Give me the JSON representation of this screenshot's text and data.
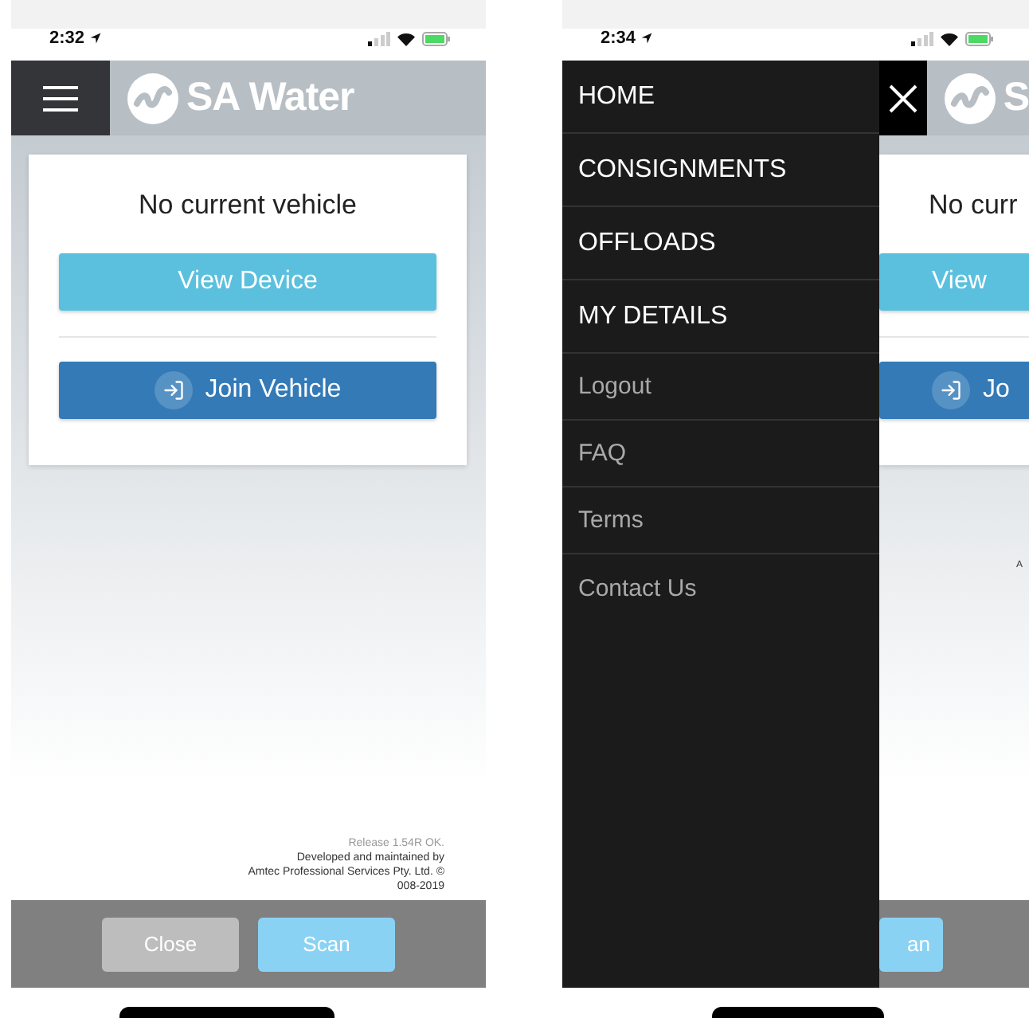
{
  "screens": [
    {
      "kind": "main",
      "status_bar": {
        "time": "2:32"
      },
      "header": {
        "logo_text": "SA Water"
      },
      "card": {
        "message": "No current vehicle",
        "buttons": [
          {
            "label": "View Device",
            "kind": "info"
          },
          {
            "label": "Join Vehicle",
            "kind": "primary"
          }
        ]
      },
      "footer": [
        "Release 1.54R OK.",
        "Developed and maintained by",
        "Amtec Professional Services Pty. Ltd. ©",
        "008-2019"
      ],
      "bottom_bar": [
        {
          "label": "Close",
          "kind": "close"
        },
        {
          "label": "Scan",
          "kind": "scan"
        }
      ]
    },
    {
      "kind": "menu_open",
      "status_bar": {
        "time": "2:34"
      },
      "menu": [
        {
          "label": "HOME",
          "kind": "main"
        },
        {
          "label": "CONSIGNMENTS",
          "kind": "main"
        },
        {
          "label": "OFFLOADS",
          "kind": "main"
        },
        {
          "label": "MY DETAILS",
          "kind": "main"
        },
        {
          "label": "Logout",
          "kind": "minor"
        },
        {
          "label": "FAQ",
          "kind": "minor"
        },
        {
          "label": "Terms",
          "kind": "minor"
        },
        {
          "label": "Contact Us",
          "kind": "minor"
        }
      ],
      "peek": {
        "logo_text": "S",
        "message": "No curr",
        "buttons": [
          {
            "label": "View",
            "kind": "info"
          },
          {
            "label": "Jo",
            "kind": "primary"
          }
        ],
        "footer": "A",
        "bottom_bar": [
          {
            "label": "an",
            "kind": "scan"
          }
        ]
      }
    }
  ]
}
